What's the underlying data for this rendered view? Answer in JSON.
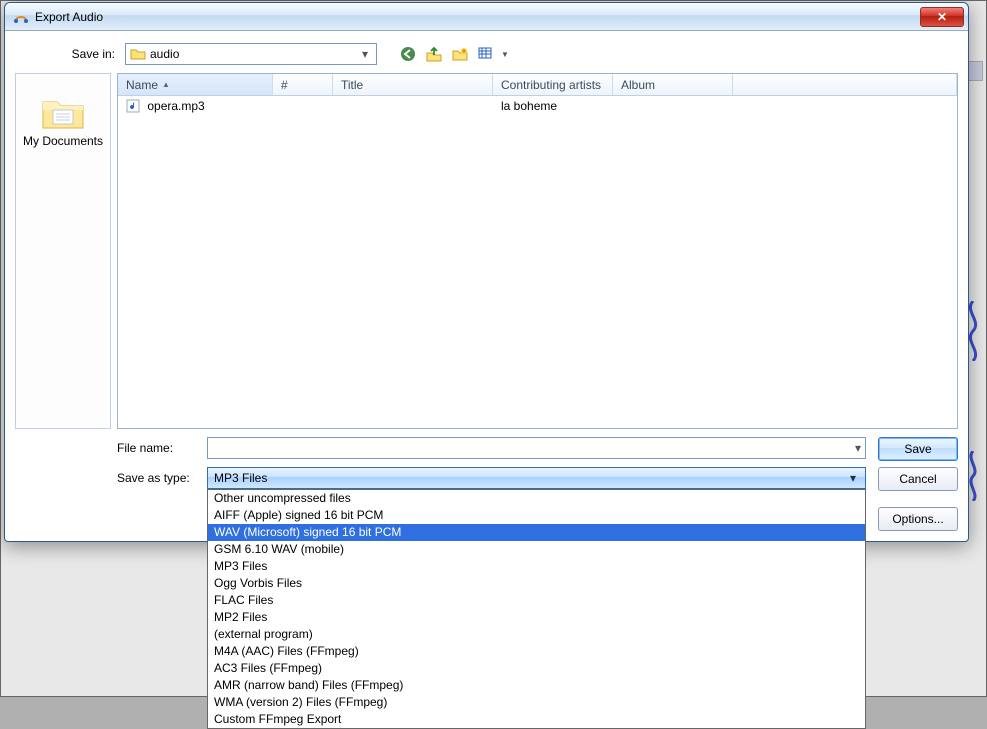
{
  "dialog": {
    "title": "Export Audio",
    "close_glyph": "✕"
  },
  "toolbar": {
    "savein_label": "Save in:",
    "savein_value": "audio"
  },
  "places": {
    "items": [
      {
        "label": "My Documents"
      }
    ]
  },
  "columns": {
    "name": "Name",
    "num": "#",
    "title": "Title",
    "artists": "Contributing artists",
    "album": "Album"
  },
  "files": [
    {
      "name": "opera.mp3",
      "num": "",
      "title": "",
      "artists": "la boheme",
      "album": ""
    }
  ],
  "form": {
    "filename_label": "File name:",
    "filename_value": "",
    "saveastype_label": "Save as type:",
    "saveastype_value": "MP3 Files"
  },
  "dropdown_options": [
    "Other uncompressed files",
    "AIFF (Apple) signed 16 bit PCM",
    "WAV (Microsoft) signed 16 bit PCM",
    "GSM 6.10 WAV (mobile)",
    "MP3 Files",
    "Ogg Vorbis Files",
    "FLAC Files",
    "MP2 Files",
    "(external program)",
    "M4A (AAC) Files (FFmpeg)",
    "AC3 Files (FFmpeg)",
    "AMR (narrow band) Files (FFmpeg)",
    "WMA (version 2) Files (FFmpeg)",
    "Custom FFmpeg Export"
  ],
  "dropdown_selected_index": 2,
  "buttons": {
    "save": "Save",
    "cancel": "Cancel",
    "options": "Options..."
  }
}
